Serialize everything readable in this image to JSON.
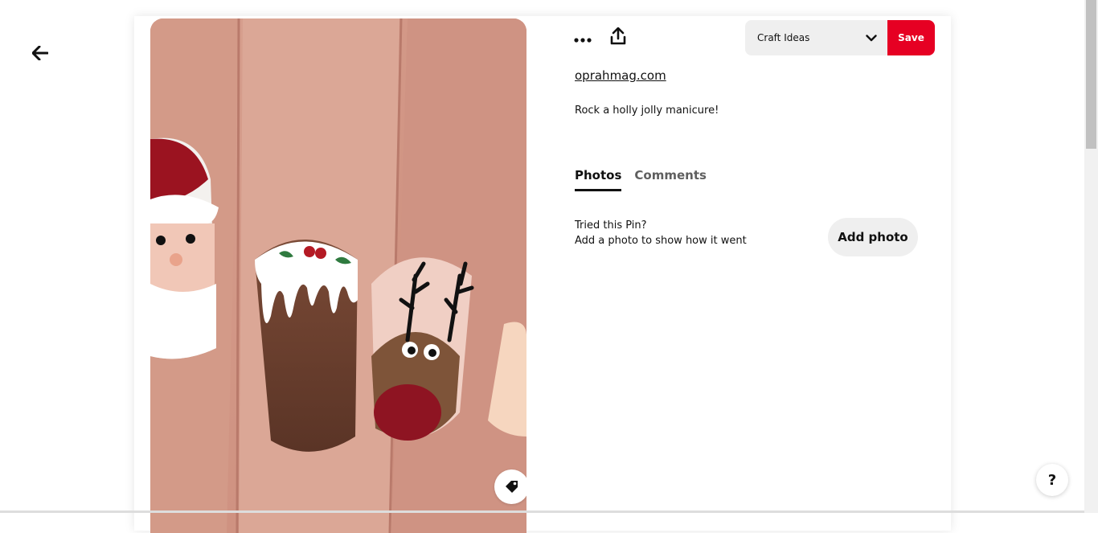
{
  "header": {
    "back_icon": "arrow-left-icon"
  },
  "pin": {
    "image_icon_tag": "tag-icon",
    "more_icon": "ellipsis-icon",
    "share_icon": "share-upload-icon",
    "source": "oprahmag.com",
    "description": "Rock a holly jolly manicure!"
  },
  "board_select": {
    "selected": "Craft Ideas",
    "chevron_icon": "chevron-down-icon"
  },
  "save_label": "Save",
  "tabs": [
    {
      "label": "Photos",
      "active": true
    },
    {
      "label": "Comments",
      "active": false
    }
  ],
  "tried": {
    "title": "Tried this Pin?",
    "subtitle": "Add a photo to show how it went",
    "add_photo_label": "Add photo"
  },
  "help": {
    "label": "?"
  },
  "colors": {
    "save_red": "#e60023",
    "chip_gray": "#efefef"
  }
}
